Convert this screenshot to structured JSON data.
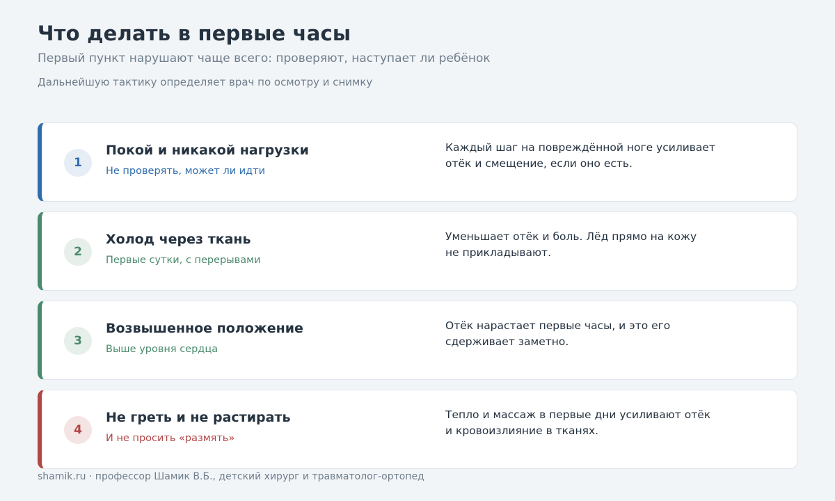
{
  "header": {
    "title": "Что делать в первые часы",
    "subtitle": "Первый пункт нарушают чаще всего: проверяют, наступает ли ребёнок",
    "note": "Дальнейшую тактику определяет врач по осмотру и снимку"
  },
  "steps": [
    {
      "number": "1",
      "title": "Покой и никакой нагрузки",
      "subtitle": "Не проверять, может ли идти",
      "desc_line1": "Каждый шаг на повреждённой ноге усиливает",
      "desc_line2": "отёк и смещение, если оно есть.",
      "accent": "#2f6cad"
    },
    {
      "number": "2",
      "title": "Холод через ткань",
      "subtitle": "Первые сутки, с перерывами",
      "desc_line1": "Уменьшает отёк и боль. Лёд прямо на кожу",
      "desc_line2": "не прикладывают.",
      "accent": "#4a8a6c"
    },
    {
      "number": "3",
      "title": "Возвышенное положение",
      "subtitle": "Выше уровня сердца",
      "desc_line1": "Отёк нарастает первые часы, и это его",
      "desc_line2": "сдерживает заметно.",
      "accent": "#4a8a6c"
    },
    {
      "number": "4",
      "title": "Не греть и не растирать",
      "subtitle": "И не просить «размять»",
      "desc_line1": "Тепло и массаж в первые дни усиливают отёк",
      "desc_line2": "и кровоизлияние в тканях.",
      "accent": "#b24545"
    }
  ],
  "footer": {
    "text": "shamik.ru · профессор Шамик В.Б., детский хирург и травматолог-ортопед"
  }
}
